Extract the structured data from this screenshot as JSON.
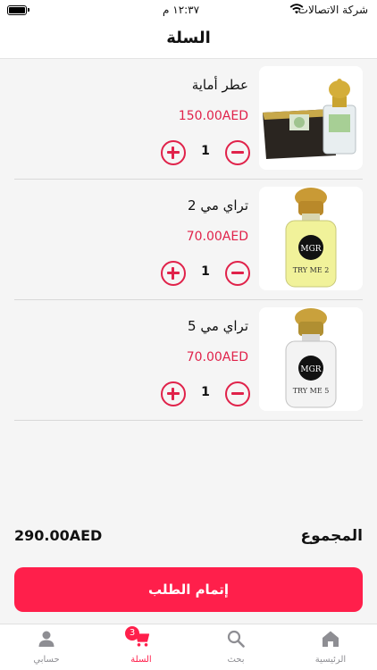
{
  "status_bar": {
    "carrier": "شركة الاتصالات",
    "time": "١٢:٣٧ م"
  },
  "header": {
    "title": "السلة"
  },
  "cart": {
    "items": [
      {
        "name": "عطر أماية",
        "price": "150.00AED",
        "quantity": "1",
        "image_icon": "perfume-gift-box-icon",
        "image_label": ""
      },
      {
        "name": "تراي مي 2",
        "price": "70.00AED",
        "quantity": "1",
        "image_icon": "perfume-bottle-icon",
        "image_label": "TRY ME 2"
      },
      {
        "name": "تراي مي 5",
        "price": "70.00AED",
        "quantity": "1",
        "image_icon": "perfume-bottle-icon",
        "image_label": "TRY ME 5"
      }
    ]
  },
  "summary": {
    "total_label": "المجموع",
    "total_value": "290.00AED"
  },
  "checkout": {
    "label": "إتمام الطلب"
  },
  "tabs": [
    {
      "label": "الرئيسية",
      "icon": "home-icon"
    },
    {
      "label": "بحث",
      "icon": "search-icon"
    },
    {
      "label": "السلة",
      "icon": "cart-icon",
      "badge": "3"
    },
    {
      "label": "حسابي",
      "icon": "person-icon"
    }
  ],
  "colors": {
    "accent": "#ff1f4b",
    "price": "#e0224a",
    "tab_inactive": "#8e8e93"
  }
}
